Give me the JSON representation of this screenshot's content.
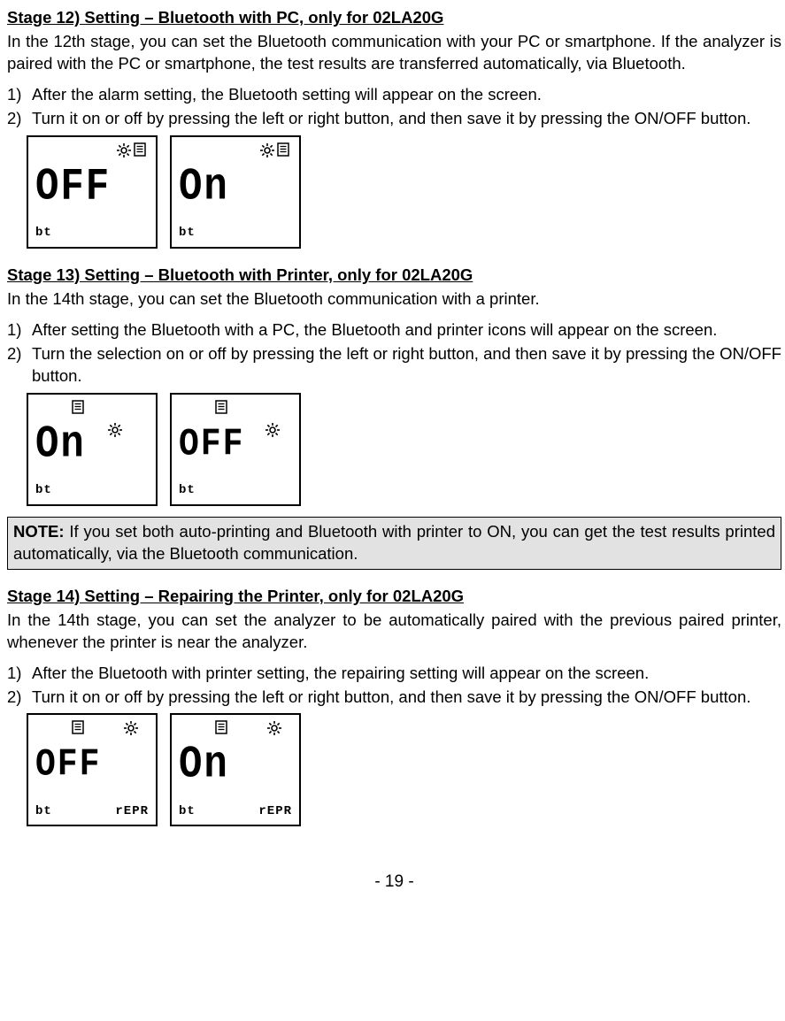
{
  "stage12": {
    "heading": "Stage 12) Setting – Bluetooth with PC, only for 02LA20G",
    "intro": "In the 12th stage, you can set the Bluetooth communication with your PC or smartphone. If the analyzer is paired with the PC or smartphone, the test results are transferred automatically, via Bluetooth.",
    "steps": [
      {
        "n": "1)",
        "t": "After the alarm setting, the Bluetooth setting will appear on the screen."
      },
      {
        "n": "2)",
        "t": "Turn it on or off by pressing the left or right button, and then save it by pressing the ON/OFF button."
      }
    ],
    "lcd": [
      {
        "main": "OFF",
        "bt": "bt"
      },
      {
        "main": "On",
        "bt": "bt"
      }
    ]
  },
  "stage13": {
    "heading": "Stage 13) Setting – Bluetooth with Printer, only for 02LA20G",
    "intro": "In the 14th stage, you can set the Bluetooth communication with a printer.",
    "steps": [
      {
        "n": "1)",
        "t": "After setting the Bluetooth with a PC, the Bluetooth and printer icons will appear on the screen."
      },
      {
        "n": "2)",
        "t": "Turn the selection on or off by pressing the left or right button, and then save it by pressing the ON/OFF button."
      }
    ],
    "lcd": [
      {
        "main": "On",
        "bt": "bt"
      },
      {
        "main": "OFF",
        "bt": "bt"
      }
    ],
    "note_label": "NOTE:",
    "note": " If you set both auto-printing and Bluetooth with printer to ON, you can get the test results printed automatically, via the Bluetooth communication."
  },
  "stage14": {
    "heading": "Stage 14) Setting – Repairing the Printer, only for 02LA20G",
    "intro": "In the 14th stage, you can set the analyzer to be automatically paired with the previous paired printer, whenever the printer is near the analyzer.",
    "steps": [
      {
        "n": "1)",
        "t": "After the Bluetooth with printer setting, the repairing setting will appear on the screen."
      },
      {
        "n": "2)",
        "t": "Turn it on or off by pressing the left or right button, and then save it by pressing the ON/OFF button."
      }
    ],
    "lcd": [
      {
        "main": "OFF",
        "bt": "bt",
        "right": "rEPR"
      },
      {
        "main": "On",
        "bt": "bt",
        "right": "rEPR"
      }
    ]
  },
  "page_number": "- 19 -",
  "icons": {
    "gear": "gear-icon",
    "document": "document-icon"
  }
}
